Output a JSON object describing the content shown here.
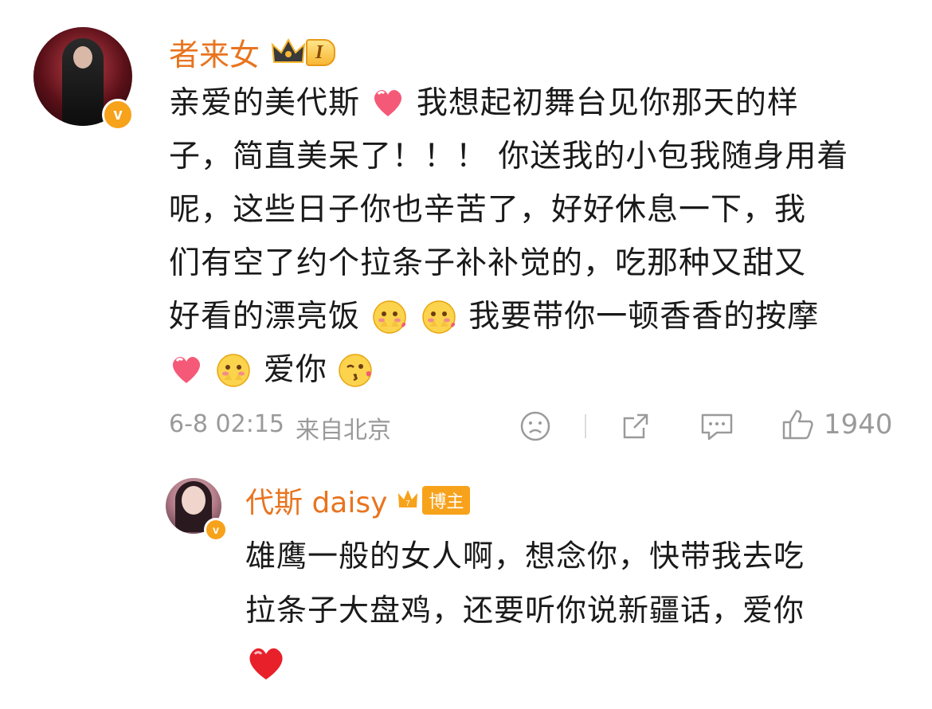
{
  "comment": {
    "username": "者来女",
    "level": "I",
    "lines": [
      [
        "亲爱的美代斯",
        "[heart]",
        "我想起初舞台见你那天的样"
      ],
      [
        "子，简直美呆了！！！ 你送我的小包我随身用着"
      ],
      [
        "呢，这些日子你也辛苦了，好好休息一下，我"
      ],
      [
        "们有空了约个拉条子补补觉的，吃那种又甜又"
      ],
      [
        "好看的漂亮饭",
        "[shy]",
        "[shy]",
        "我要带你一顿香香的按摩"
      ],
      [
        "[heart]",
        "[shy]",
        "爱你",
        "[kiss]"
      ]
    ],
    "time": "6-8 02:15",
    "location": "来自北京",
    "like_count": "1940"
  },
  "reply": {
    "username": "代斯 daisy",
    "badge": "博主",
    "lines": [
      "雄鹰一般的女人啊，想念你，快带我去吃",
      "拉条子大盘鸡，还要听你说新疆话，爱你"
    ],
    "trailing_emoji": "heart-red-icon"
  },
  "colors": {
    "username": "#e8741f",
    "meta": "#9a9a9a",
    "vip_badge": "#f7a21b"
  }
}
